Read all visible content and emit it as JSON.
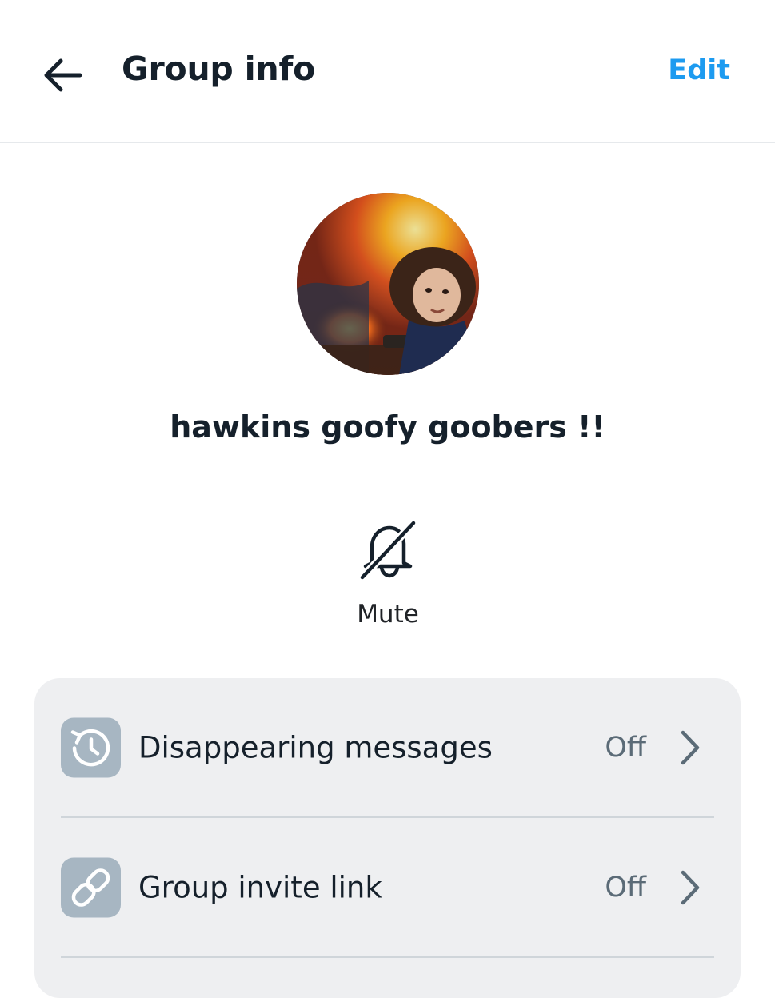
{
  "header": {
    "title": "Group info",
    "edit_label": "Edit",
    "back_icon": "arrow-left-icon"
  },
  "group": {
    "name": "hawkins goofy goobers !!"
  },
  "actions": {
    "mute": {
      "label": "Mute",
      "icon": "bell-slash-icon"
    }
  },
  "settings": [
    {
      "label": "Disappearing messages",
      "value": "Off",
      "icon": "timer-history-icon"
    },
    {
      "label": "Group invite link",
      "value": "Off",
      "icon": "link-icon"
    }
  ],
  "colors": {
    "accent": "#1d9bf0",
    "text": "#15202b",
    "secondary_text": "#5b6b77",
    "card_bg": "#eeeff1",
    "icon_tile_bg": "#a7b6c2"
  }
}
